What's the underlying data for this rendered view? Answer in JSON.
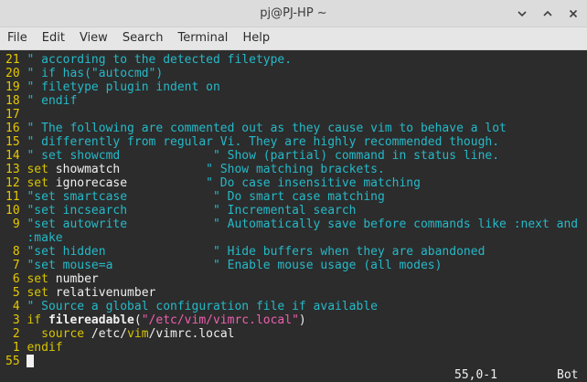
{
  "window": {
    "title": "pj@PJ-HP ~",
    "buttons": {
      "minimize": "minimize-icon",
      "maximize": "maximize-icon",
      "close": "close-icon"
    }
  },
  "menu": [
    "File",
    "Edit",
    "View",
    "Search",
    "Terminal",
    "Help"
  ],
  "editor": {
    "lines": [
      [
        {
          "c": "ln",
          "t": "21 "
        },
        {
          "c": "cm",
          "t": "\" according to the detected filetype."
        }
      ],
      [
        {
          "c": "ln",
          "t": "20 "
        },
        {
          "c": "cm",
          "t": "\" if has(\"autocmd\")"
        }
      ],
      [
        {
          "c": "ln",
          "t": "19 "
        },
        {
          "c": "cm",
          "t": "\" filetype plugin indent on"
        }
      ],
      [
        {
          "c": "ln",
          "t": "18 "
        },
        {
          "c": "cm",
          "t": "\" endif"
        }
      ],
      [
        {
          "c": "ln",
          "t": "17"
        }
      ],
      [
        {
          "c": "ln",
          "t": "16 "
        },
        {
          "c": "cm",
          "t": "\" The following are commented out as they cause vim to behave a lot"
        }
      ],
      [
        {
          "c": "ln",
          "t": "15 "
        },
        {
          "c": "cm",
          "t": "\" differently from regular Vi. They are highly recommended though."
        }
      ],
      [
        {
          "c": "ln",
          "t": "14 "
        },
        {
          "c": "cm",
          "t": "\" set showcmd             \" Show (partial) command in status line."
        }
      ],
      [
        {
          "c": "ln",
          "t": "13 "
        },
        {
          "c": "kw",
          "t": "set"
        },
        {
          "c": "tx",
          "t": " showmatch"
        },
        {
          "c": "cm",
          "t": "            \" Show matching brackets."
        }
      ],
      [
        {
          "c": "ln",
          "t": "12 "
        },
        {
          "c": "kw",
          "t": "set"
        },
        {
          "c": "tx",
          "t": " ignorecase"
        },
        {
          "c": "cm",
          "t": "           \" Do case insensitive matching"
        }
      ],
      [
        {
          "c": "ln",
          "t": "11 "
        },
        {
          "c": "cm",
          "t": "\"set smartcase            \" Do smart case matching"
        }
      ],
      [
        {
          "c": "ln",
          "t": "10 "
        },
        {
          "c": "cm",
          "t": "\"set incsearch            \" Incremental search"
        }
      ],
      [
        {
          "c": "ln",
          "t": " 9 "
        },
        {
          "c": "cm",
          "t": "\"set autowrite            \" Automatically save before commands like :next and"
        }
      ],
      [
        {
          "c": "ln",
          "t": "   "
        },
        {
          "c": "cm",
          "t": ":make"
        }
      ],
      [
        {
          "c": "ln",
          "t": " 8 "
        },
        {
          "c": "cm",
          "t": "\"set hidden               \" Hide buffers when they are abandoned"
        }
      ],
      [
        {
          "c": "ln",
          "t": " 7 "
        },
        {
          "c": "cm",
          "t": "\"set mouse=a              \" Enable mouse usage (all modes)"
        }
      ],
      [
        {
          "c": "ln",
          "t": " 6 "
        },
        {
          "c": "kw",
          "t": "set"
        },
        {
          "c": "tx",
          "t": " number"
        }
      ],
      [
        {
          "c": "ln",
          "t": " 5 "
        },
        {
          "c": "kw",
          "t": "set"
        },
        {
          "c": "tx",
          "t": " relativenumber"
        }
      ],
      [
        {
          "c": "ln",
          "t": " 4 "
        },
        {
          "c": "cm",
          "t": "\" Source a global configuration file if available"
        }
      ],
      [
        {
          "c": "ln",
          "t": " 3 "
        },
        {
          "c": "kw",
          "t": "if"
        },
        {
          "c": "tx",
          "t": " "
        },
        {
          "c": "bd",
          "t": "filereadable"
        },
        {
          "c": "tx",
          "t": "("
        },
        {
          "c": "st",
          "t": "\"/etc/vim/vimrc.local\""
        },
        {
          "c": "tx",
          "t": ")"
        }
      ],
      [
        {
          "c": "ln",
          "t": " 2 "
        },
        {
          "c": "tx",
          "t": "  "
        },
        {
          "c": "kw",
          "t": "source"
        },
        {
          "c": "tx",
          "t": " /etc/"
        },
        {
          "c": "kw",
          "t": "vim"
        },
        {
          "c": "tx",
          "t": "/vimrc.local"
        }
      ],
      [
        {
          "c": "ln",
          "t": " 1 "
        },
        {
          "c": "kw",
          "t": "endif"
        }
      ]
    ],
    "cursor_line_number": "55",
    "status_position": "55,0-1",
    "status_scroll": "Bot"
  },
  "colors": {
    "line_number": "#e6c800",
    "comment": "#25b9c8",
    "keyword": "#d8c400",
    "string": "#ee5fb0",
    "text": "#f0f0f0",
    "background": "#2c2c2c"
  }
}
